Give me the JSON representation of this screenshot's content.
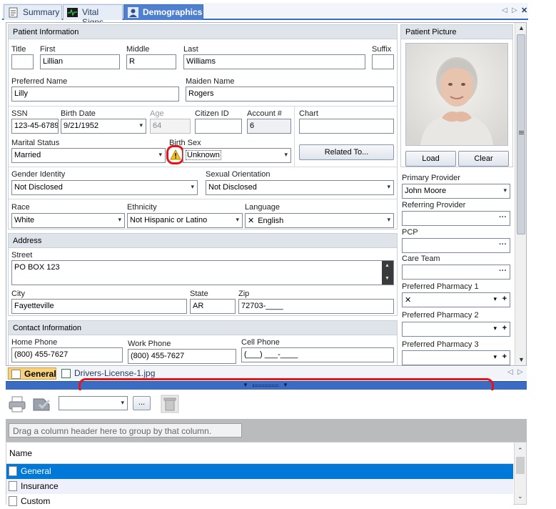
{
  "tabs": [
    {
      "label": "Summary",
      "icon": "summary-icon"
    },
    {
      "label": "Vital Signs",
      "icon": "vital-signs-icon"
    },
    {
      "label": "Demographics",
      "icon": "person-icon"
    }
  ],
  "window_controls": {
    "prev": "◁",
    "next": "▷",
    "close": "✕"
  },
  "patient_info": {
    "header": "Patient Information",
    "title_label": "Title",
    "title_value": "",
    "first_label": "First",
    "first_value": "Lillian",
    "middle_label": "Middle",
    "middle_value": "R",
    "last_label": "Last",
    "last_value": "Williams",
    "suffix_label": "Suffix",
    "suffix_value": "",
    "preferred_label": "Preferred Name",
    "preferred_value": "Lilly",
    "maiden_label": "Maiden Name",
    "maiden_value": "Rogers",
    "ssn_label": "SSN",
    "ssn_value": "123-45-6789",
    "birthdate_label": "Birth Date",
    "birthdate_value": "9/21/1952",
    "age_label": "Age",
    "age_value": "64",
    "citizen_label": "Citizen ID",
    "citizen_value": "",
    "account_label": "Account #",
    "account_value": "6",
    "chart_label": "Chart",
    "chart_value": "",
    "marital_label": "Marital Status",
    "marital_value": "Married",
    "birthsex_label": "Birth Sex",
    "birthsex_value": "Unknown",
    "related_button": "Related To...",
    "gender_label": "Gender Identity",
    "gender_value": "Not Disclosed",
    "orientation_label": "Sexual Orientation",
    "orientation_value": "Not Disclosed",
    "race_label": "Race",
    "race_value": "White",
    "ethnicity_label": "Ethnicity",
    "ethnicity_value": "Not Hispanic or Latino",
    "language_label": "Language",
    "language_value": "English"
  },
  "address": {
    "header": "Address",
    "street_label": "Street",
    "street_value": "PO BOX 123",
    "city_label": "City",
    "city_value": "Fayetteville",
    "state_label": "State",
    "state_value": "AR",
    "zip_label": "Zip",
    "zip_value": "72703-____"
  },
  "contact": {
    "header": "Contact Information",
    "home_label": "Home Phone",
    "home_value": "(800) 455-7627",
    "work_label": "Work Phone",
    "work_value": "(800) 455-7627",
    "cell_label": "Cell Phone",
    "cell_value": "(___) ___-____"
  },
  "picture": {
    "header": "Patient Picture",
    "load_button": "Load",
    "clear_button": "Clear"
  },
  "providers": {
    "primary_label": "Primary Provider",
    "primary_value": "John Moore",
    "referring_label": "Referring Provider",
    "referring_value": "",
    "pcp_label": "PCP",
    "pcp_value": "",
    "careteam_label": "Care Team",
    "careteam_value": "",
    "pharm1_label": "Preferred Pharmacy 1",
    "pharm2_label": "Preferred Pharmacy 2",
    "pharm3_label": "Preferred Pharmacy 3"
  },
  "bottom_tabs": [
    {
      "label": "General"
    },
    {
      "label": "Drivers-License-1.jpg"
    }
  ],
  "toolbar": {
    "ellipsis": "..."
  },
  "group_hint": "Drag a column header here to group by that column.",
  "grid": {
    "column": "Name",
    "rows": [
      "General",
      "Insurance",
      "Custom"
    ],
    "selected_index": 0
  },
  "colors": {
    "accent": "#3b6cc4",
    "selection": "#0078d7",
    "highlight_ring": "#e3141b"
  }
}
